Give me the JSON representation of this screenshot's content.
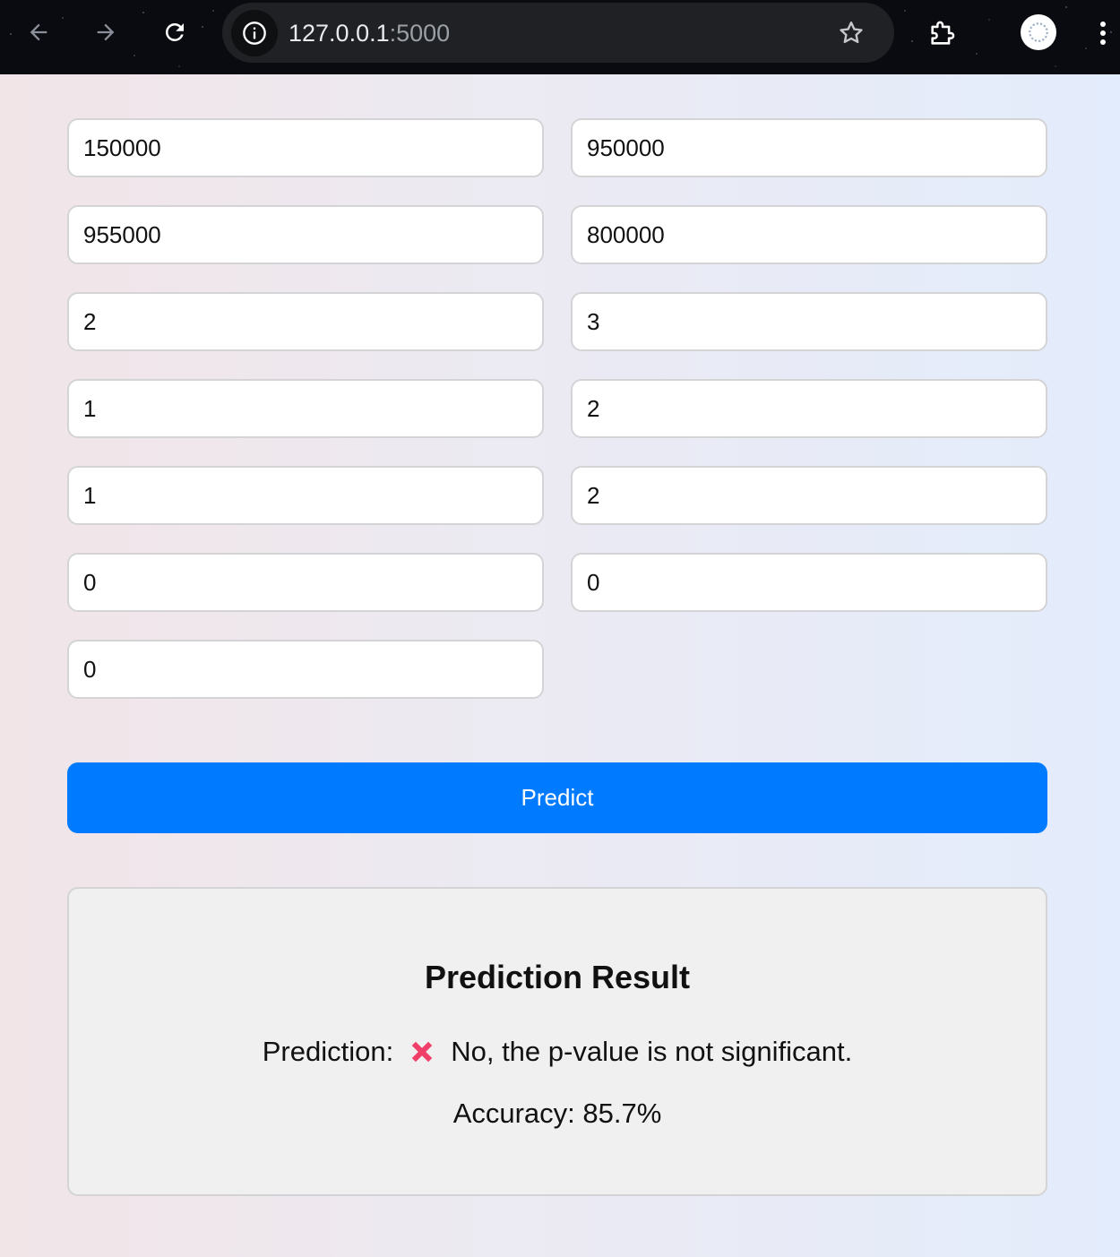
{
  "browser": {
    "url_host": "127.0.0.1",
    "url_port": ":5000",
    "icons": [
      "back-arrow-icon",
      "forward-arrow-icon",
      "reload-icon",
      "info-icon",
      "star-icon",
      "extensions-icon",
      "profile-avatar-icon",
      "more-vert-icon"
    ]
  },
  "form": {
    "fields": [
      {
        "value": "150000"
      },
      {
        "value": "950000"
      },
      {
        "value": "955000"
      },
      {
        "value": "800000"
      },
      {
        "value": "2"
      },
      {
        "value": "3"
      },
      {
        "value": "1"
      },
      {
        "value": "2"
      },
      {
        "value": "1"
      },
      {
        "value": "2"
      },
      {
        "value": "0"
      },
      {
        "value": "0"
      },
      {
        "value": "0"
      }
    ],
    "submit_label": "Predict"
  },
  "result": {
    "title": "Prediction Result",
    "prediction_label": "Prediction:",
    "prediction_icon": "cross-mark-icon",
    "prediction_text": "No, the p-value is not significant.",
    "accuracy_text": "Accuracy: 85.7%"
  },
  "colors": {
    "accent": "#007bff",
    "cross_mark": "#f0406a",
    "card_bg": "#f0f0f0"
  }
}
